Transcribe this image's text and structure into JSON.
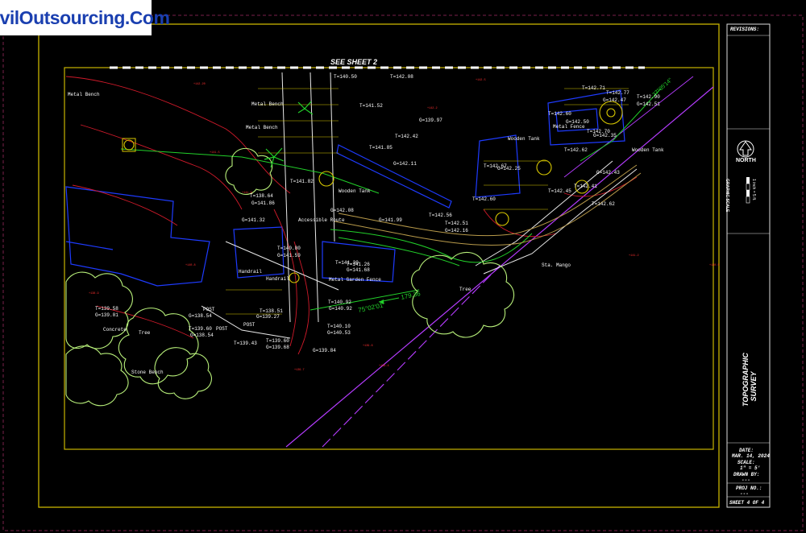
{
  "logo": {
    "text": "CivilOutsourcing.Com"
  },
  "sheet": {
    "see_sheet": "SEE SHEET 2",
    "title": "TOPOGRAPHIC SURVEY",
    "north": "NORTH",
    "graphic_scale": "GRAPHIC SCALE",
    "scale_note": "1 inch = 5 ft.",
    "revisions": "REVISIONS:",
    "date_label": "DATE:",
    "date_value": "MAR. 14, 2024",
    "scale_label": "SCALE:",
    "scale_value": "1\" = 5'",
    "drawn_label": "DRAWN BY:",
    "drawn_value": "---",
    "proj_label": "PROJ NO.:",
    "proj_value": "---",
    "sheet_no": "SHEET 4 OF 4"
  },
  "labels": {
    "metal_bench_1": "Metal Bench",
    "metal_bench_2": "Metal Bench",
    "metal_bench_3": "Metal Bench",
    "metal_fence": "Metal Fence",
    "wooden_tank_1": "Wooden Tank",
    "wooden_tank_2": "Wooden Tank",
    "wooden_tank_3": "Wooden Tank",
    "handrail_1": "Handrail",
    "handrail_2": "Handrail",
    "metal_garden_fence": "Metal Garden Fence",
    "accessible_route": "Accessible Route",
    "concrete": "Concrete",
    "stone_bench": "Stone Bench",
    "sta_mango": "Sta. Mango",
    "post_1": "POST",
    "post_2": "POST",
    "post_3": "POST",
    "tree_1": "Tree",
    "tree_2": "Tree",
    "bearing": "75°02'01\"",
    "distance": "179.36"
  },
  "spot_elevations": [
    "T=142.71",
    "T=142.77",
    "T=142.90",
    "T=142.60",
    "T=142.70",
    "T=142.62",
    "T=142.67",
    "T=142.45",
    "T=142.51",
    "T=142.56",
    "T=142.60",
    "T=142.41",
    "T=142.62",
    "T=141.30",
    "T=141.26",
    "T=140.92",
    "T=140.10",
    "T=139.60",
    "T=139.43",
    "T=139.58",
    "T=139.60",
    "T=138.51",
    "T=138.64",
    "T=140.80",
    "T=140.50",
    "T=141.52",
    "T=142.08",
    "T=141.85",
    "T=142.42",
    "T=141.82"
  ],
  "ground_elevations": [
    "G=142.47",
    "G=142.51",
    "G=142.35",
    "G=142.50",
    "G=142.43",
    "G=142.25",
    "G=142.16",
    "G=141.99",
    "G=142.11",
    "G=141.86",
    "G=142.08",
    "G=141.68",
    "G=140.92",
    "G=140.53",
    "G=139.68",
    "G=139.84",
    "G=139.27",
    "G=138.54",
    "G=138.54",
    "G=139.01",
    "G=139.97",
    "G=141.59",
    "G=141.32"
  ]
}
